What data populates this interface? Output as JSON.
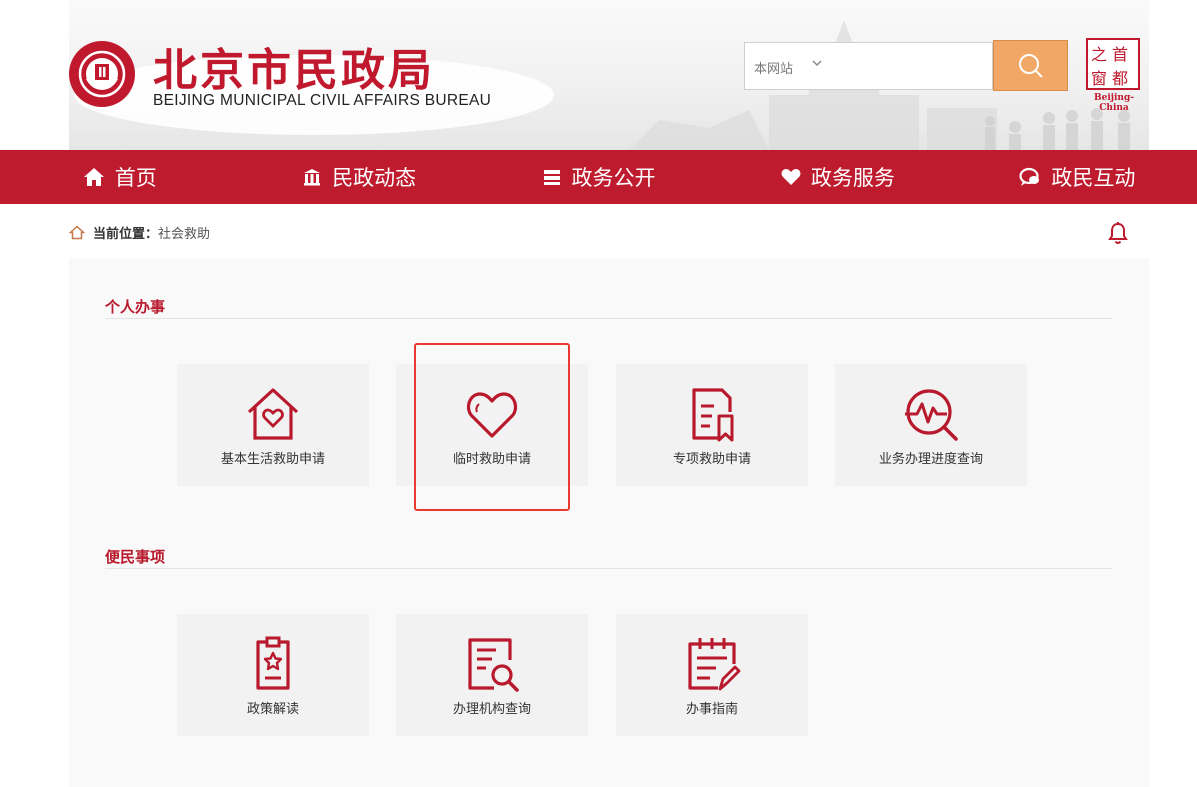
{
  "header": {
    "title": "北京市民政局",
    "subtitle": "BEIJING MUNICIPAL CIVIL AFFAIRS BUREAU",
    "search": {
      "scope": "本网站",
      "value": ""
    },
    "capital_logo": {
      "chars": [
        "首",
        "都",
        "之",
        "窗"
      ],
      "foot": "Beijing-China"
    }
  },
  "nav": {
    "items": [
      {
        "label": "首页",
        "icon": "home-icon"
      },
      {
        "label": "民政动态",
        "icon": "building-icon"
      },
      {
        "label": "政务公开",
        "icon": "stack-icon"
      },
      {
        "label": "政务服务",
        "icon": "heart-icon"
      },
      {
        "label": "政民互动",
        "icon": "chat-icon"
      }
    ]
  },
  "breadcrumb": {
    "label": "当前位置：",
    "current": "社会救助"
  },
  "sections": [
    {
      "title": "个人办事",
      "tiles": [
        {
          "label": "基本生活救助申请",
          "icon": "house-heart-icon"
        },
        {
          "label": "临时救助申请",
          "icon": "heart-outline-icon"
        },
        {
          "label": "专项救助申请",
          "icon": "document-bookmark-icon"
        },
        {
          "label": "业务办理进度查询",
          "icon": "pulse-search-icon"
        }
      ]
    },
    {
      "title": "便民事项",
      "tiles": [
        {
          "label": "政策解读",
          "icon": "document-star-icon"
        },
        {
          "label": "办理机构查询",
          "icon": "document-search-icon"
        },
        {
          "label": "办事指南",
          "icon": "calendar-pen-icon"
        }
      ]
    }
  ],
  "colors": {
    "brand": "#bf1b2e",
    "search_button": "#f1a766",
    "highlight": "#e83a2e"
  }
}
